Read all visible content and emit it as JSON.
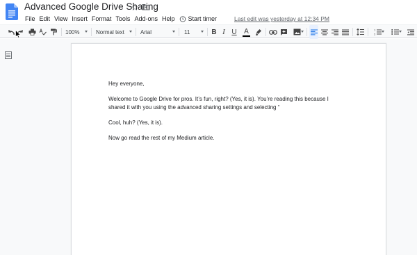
{
  "app": {
    "title": "Advanced Google Drive Sharing",
    "last_edit": "Last edit was yesterday at 12:34 PM"
  },
  "menu": [
    "File",
    "Edit",
    "View",
    "Insert",
    "Format",
    "Tools",
    "Add-ons",
    "Help"
  ],
  "start_timer": "Start timer",
  "toolbar": {
    "zoom": "100%",
    "style": "Normal text",
    "font": "Arial",
    "font_size": "11"
  },
  "document": {
    "paragraphs": [
      "Hey everyone,",
      "Welcome to Google Drive for pros. It’s fun, right? (Yes, it is). You’re reading this because I shared it with you using the advanced sharing settings and selecting “",
      " Cool, huh? (Yes, it is).",
      "Now go read the rest of my Medium article."
    ]
  },
  "colors": {
    "docs_blue": "#4285f4",
    "text_color_bar": "#000000",
    "active_align_bg": "#e8f0fe"
  }
}
